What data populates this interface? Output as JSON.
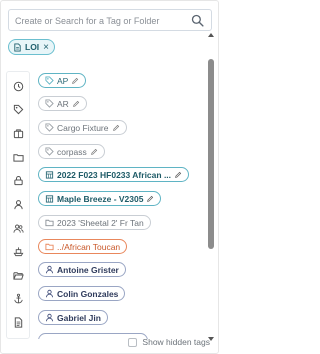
{
  "search": {
    "placeholder": "Create or Search for a Tag or Folder",
    "icon": "search-icon"
  },
  "selected_tags": [
    {
      "label": "LOI",
      "icon": "document-icon"
    }
  ],
  "rail_icons": [
    "clock-icon",
    "tag-icon",
    "briefcase-icon",
    "folder-icon",
    "lock-icon",
    "person-icon",
    "people-icon",
    "ship-icon",
    "open-folder-icon",
    "anchor-icon",
    "document-icon"
  ],
  "tags": [
    {
      "label": "AP",
      "icon": "tag-icon",
      "style": "teal",
      "editable": true
    },
    {
      "label": "AR",
      "icon": "tag-icon",
      "style": "grey",
      "editable": true
    },
    {
      "label": "Cargo Fixture",
      "icon": "tag-icon",
      "style": "grey",
      "editable": true
    },
    {
      "label": "corpass",
      "icon": "tag-icon",
      "style": "grey",
      "editable": true
    },
    {
      "label": "2022 F023 HF0233 African ...",
      "icon": "ship-icon",
      "style": "teal-bold",
      "editable": true
    },
    {
      "label": "Maple Breeze - V2305",
      "icon": "ship-icon",
      "style": "teal-bold",
      "editable": true
    },
    {
      "label": "2023 'Sheetal 2' Fr Tan",
      "icon": "folder-icon",
      "style": "grey",
      "editable": false
    },
    {
      "label": "../African Toucan",
      "icon": "folder-icon",
      "style": "orange",
      "editable": false
    },
    {
      "label": "Antoine Grister",
      "icon": "person-icon",
      "style": "person",
      "editable": false
    },
    {
      "label": "Colin Gonzales",
      "icon": "person-icon",
      "style": "person",
      "editable": false
    },
    {
      "label": "Gabriel Jin",
      "icon": "person-icon",
      "style": "person",
      "editable": false
    }
  ],
  "footer": {
    "show_hidden_label": "Show hidden tags"
  },
  "colors": {
    "teal": "#5fb4c4",
    "orange": "#e9875c",
    "person": "#9aa6c4"
  }
}
